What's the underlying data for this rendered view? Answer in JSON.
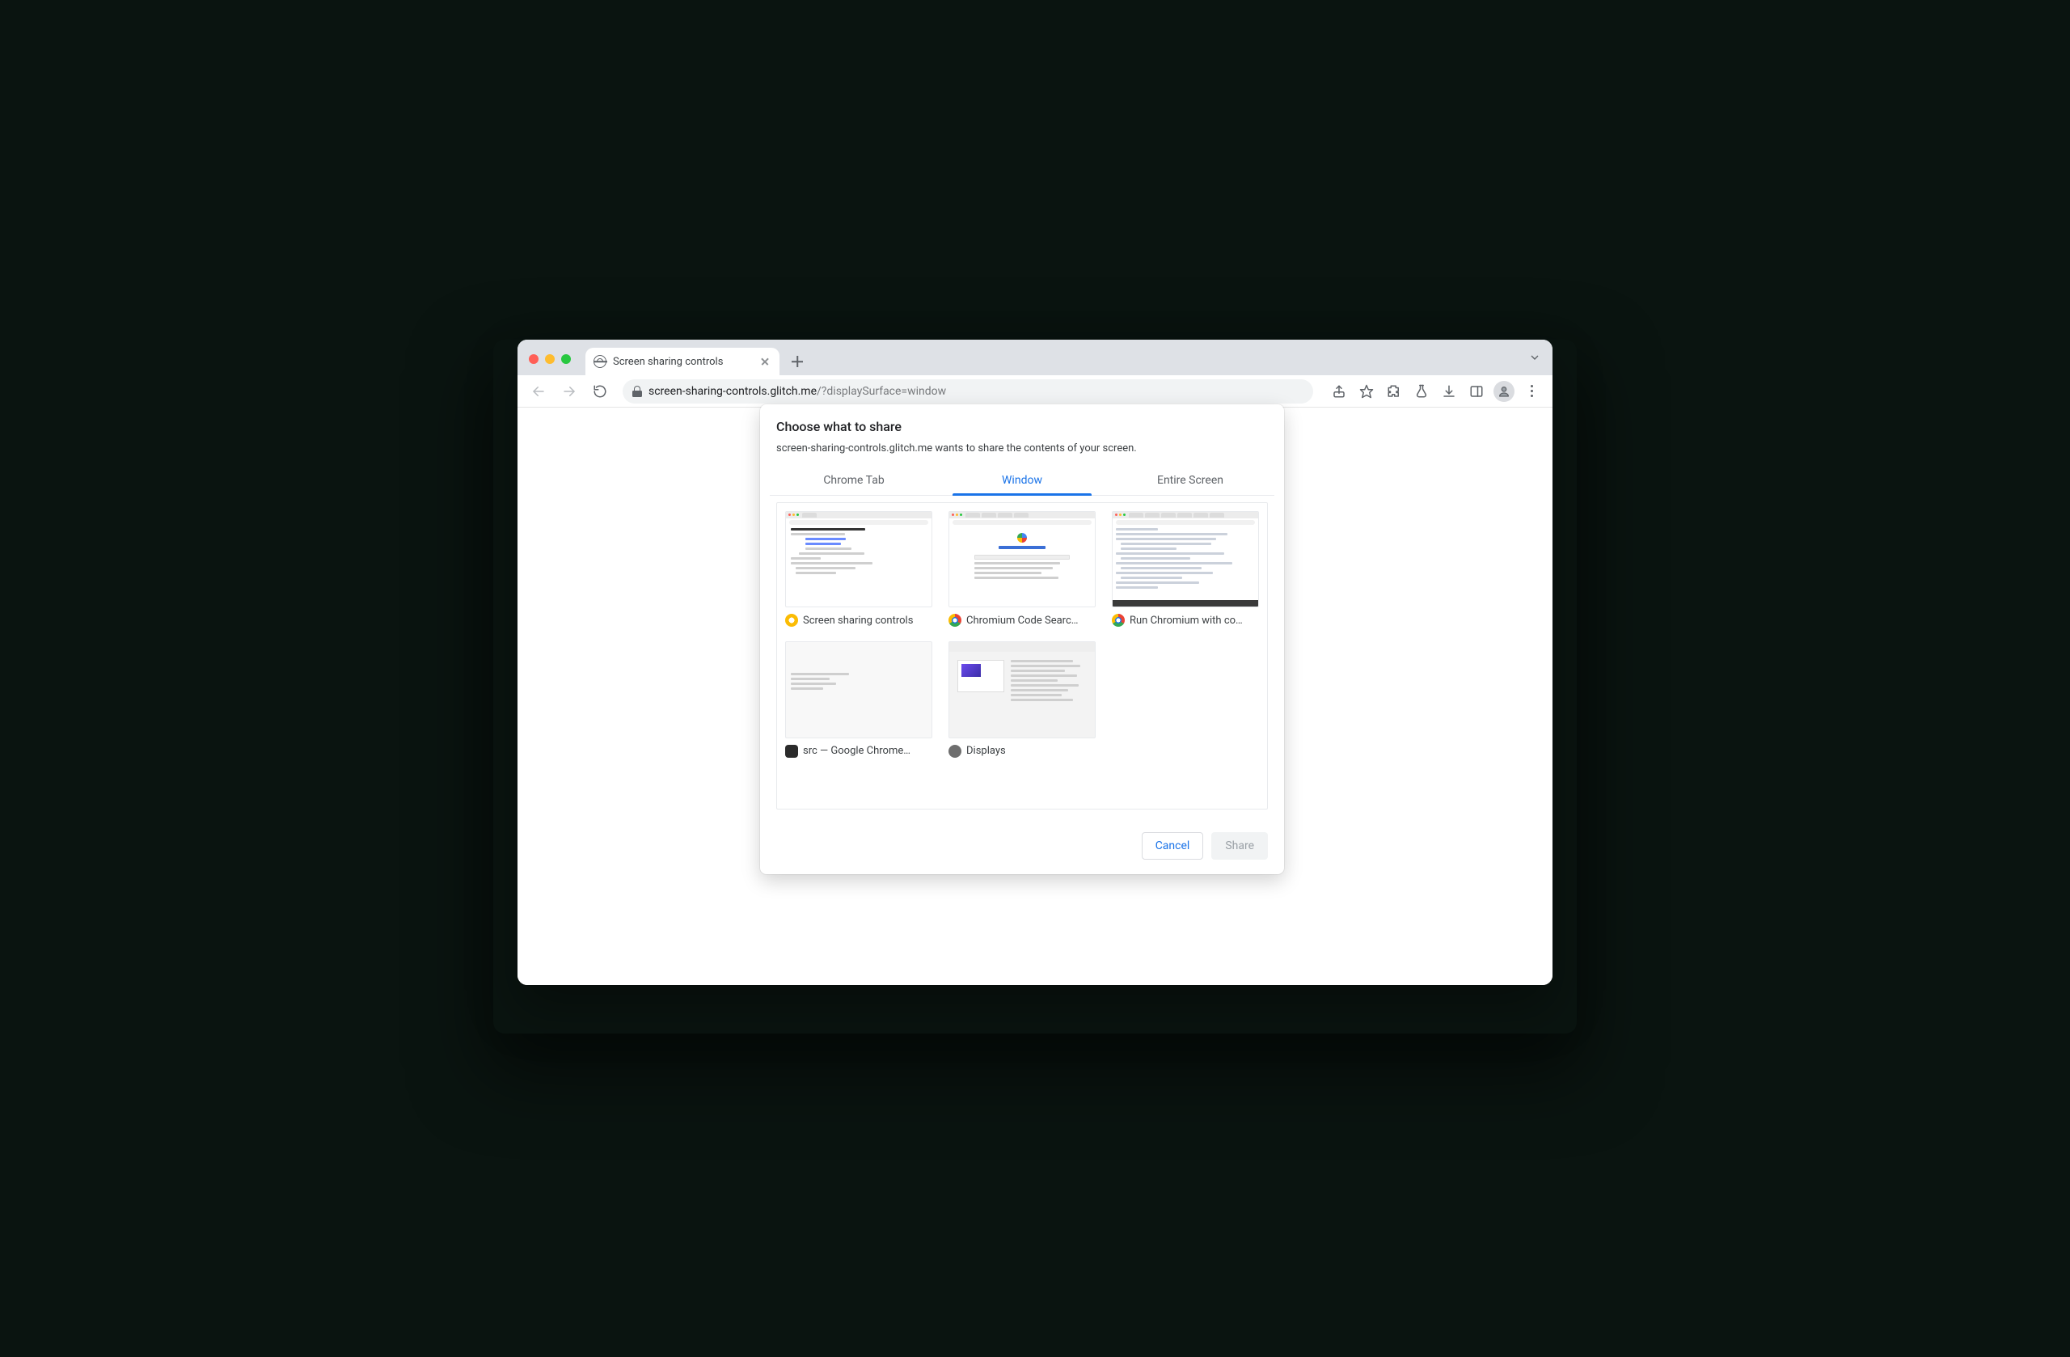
{
  "browser": {
    "tab_title": "Screen sharing controls",
    "url_host": "screen-sharing-controls.glitch.me",
    "url_path": "/?displaySurface=window"
  },
  "dialog": {
    "title": "Choose what to share",
    "subtitle": "screen-sharing-controls.glitch.me wants to share the contents of your screen.",
    "tabs": {
      "chrome_tab": "Chrome Tab",
      "window": "Window",
      "entire_screen": "Entire Screen",
      "active": "window"
    },
    "windows": [
      {
        "label": "Screen sharing controls",
        "icon": "canary"
      },
      {
        "label": "Chromium Code Searc…",
        "icon": "chrome"
      },
      {
        "label": "Run Chromium with co…",
        "icon": "chrome"
      },
      {
        "label": "src — Google Chrome…",
        "icon": "dark"
      },
      {
        "label": "Displays",
        "icon": "grey"
      }
    ],
    "buttons": {
      "cancel": "Cancel",
      "share": "Share"
    }
  }
}
